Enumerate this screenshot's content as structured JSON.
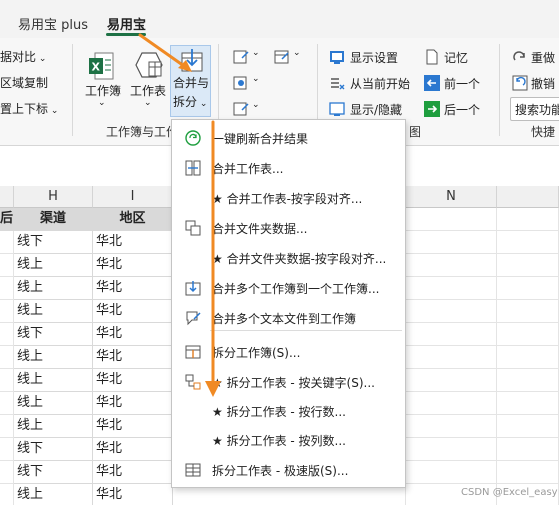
{
  "tabs": [
    {
      "label": "易用宝 plus",
      "active": false
    },
    {
      "label": "易用宝",
      "active": true
    }
  ],
  "ribbon": {
    "left_partial": {
      "item1": "据对比",
      "item2": "区域复制",
      "item3": "置上下标"
    },
    "workbook_group": {
      "workbook_label": "工作簿",
      "worksheet_label": "工作表",
      "merge_split_line1": "合并与",
      "merge_split_line2": "拆分",
      "group_label": "工作簿与工作"
    },
    "display": {
      "show_settings": "显示设置",
      "from_current": "从当前开始",
      "show_hide": "显示/隐藏",
      "memo": "记忆",
      "prev": "前一个",
      "next": "后一个",
      "group_tail": "图"
    },
    "right_partial": {
      "rerun": "重做",
      "undo": "撤销",
      "search_placeholder": "搜索功能",
      "group_label": "快捷"
    }
  },
  "sheet": {
    "columns": [
      "H",
      "I",
      "N"
    ],
    "partial_header_left": "后",
    "headers": [
      "渠道",
      "地区"
    ],
    "rows": [
      [
        "线下",
        "华北"
      ],
      [
        "线上",
        "华北"
      ],
      [
        "线上",
        "华北"
      ],
      [
        "线上",
        "华北"
      ],
      [
        "线下",
        "华北"
      ],
      [
        "线上",
        "华北"
      ],
      [
        "线上",
        "华北"
      ],
      [
        "线上",
        "华北"
      ],
      [
        "线上",
        "华北"
      ],
      [
        "线下",
        "华北"
      ],
      [
        "线下",
        "华北"
      ],
      [
        "线上",
        "华北"
      ]
    ]
  },
  "menu": {
    "items": [
      {
        "label": "一键刷新合并结果",
        "icon": "refresh-icon"
      },
      {
        "label": "合并工作表...",
        "icon": "merge-sheets-icon"
      },
      {
        "label": "★ 合并工作表-按字段对齐...",
        "icon": ""
      },
      {
        "label": "合并文件夹数据...",
        "icon": "merge-folder-icon"
      },
      {
        "label": "★ 合并文件夹数据-按字段对齐...",
        "icon": ""
      },
      {
        "label": "合并多个工作簿到一个工作簿...",
        "icon": "merge-workbooks-icon"
      },
      {
        "label": "合并多个文本文件到工作簿",
        "icon": "merge-text-icon"
      },
      {
        "label": "拆分工作簿(S)...",
        "icon": "split-workbook-icon"
      },
      {
        "label": "★ 拆分工作表 - 按关键字(S)...",
        "icon": "split-keyword-icon"
      },
      {
        "label": "★ 拆分工作表 - 按行数...",
        "icon": ""
      },
      {
        "label": "★ 拆分工作表 - 按列数...",
        "icon": ""
      },
      {
        "label": "拆分工作表 - 极速版(S)...",
        "icon": "split-fast-icon"
      }
    ]
  },
  "annotation_color": "#f08a24",
  "watermark": "CSDN @Excel_easy"
}
